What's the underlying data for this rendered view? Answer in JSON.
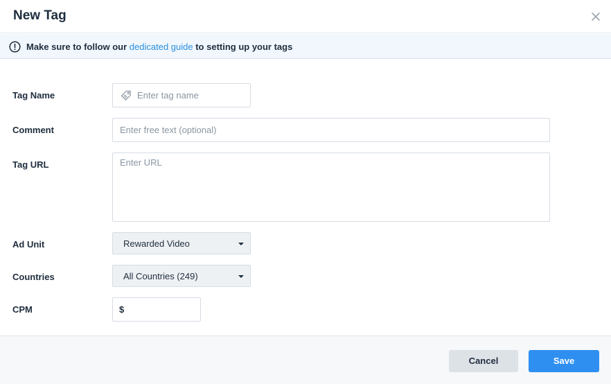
{
  "dialog": {
    "title": "New Tag",
    "close_icon": "close-icon"
  },
  "notice": {
    "icon": "exclamation-circle-icon",
    "text_before": "Make sure to follow our ",
    "link_text": "dedicated guide",
    "text_after": " to setting up your tags"
  },
  "form": {
    "tag_name": {
      "label": "Tag Name",
      "placeholder": "Enter tag name",
      "value": "",
      "icon": "tag-icon"
    },
    "comment": {
      "label": "Comment",
      "placeholder": "Enter free text (optional)",
      "value": ""
    },
    "tag_url": {
      "label": "Tag URL",
      "placeholder": "Enter URL",
      "value": ""
    },
    "ad_unit": {
      "label": "Ad Unit",
      "selected": "Rewarded Video",
      "icon": "caret-down-icon"
    },
    "countries": {
      "label": "Countries",
      "selected": "All Countries (249)",
      "icon": "caret-down-icon"
    },
    "cpm": {
      "label": "CPM",
      "currency": "$",
      "value": ""
    }
  },
  "footer": {
    "cancel_label": "Cancel",
    "save_label": "Save"
  },
  "colors": {
    "accent": "#2e8ff0",
    "link": "#2a8fe0",
    "notice_bg": "#f1f7fd",
    "footer_bg": "#f6f8fa"
  }
}
